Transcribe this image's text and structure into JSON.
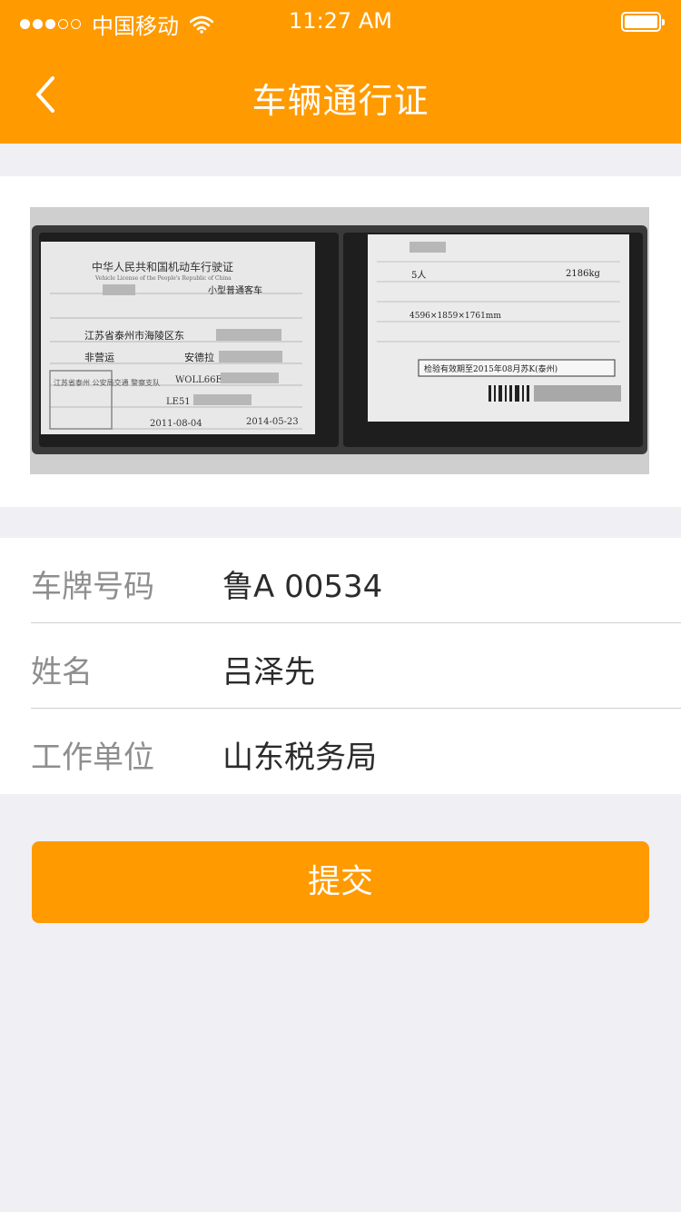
{
  "status_bar": {
    "carrier": "中国移动",
    "time": "11:27 AM",
    "signal_icon": "signal-dots-icon",
    "wifi_icon": "wifi-icon",
    "battery_icon": "battery-icon"
  },
  "nav": {
    "title": "车辆通行证",
    "back_icon": "chevron-left-icon"
  },
  "license_photo": {
    "left_page": {
      "title": "中华人民共和国机动车行驶证",
      "vehicle_type": "小型普通客车",
      "address": "江苏省泰州市海陵区东",
      "use_nature": "非营运",
      "brand": "安德拉",
      "vin": "WOLL66E15",
      "engine": "LE51",
      "register_date": "2011-08-04",
      "issue_date": "2014-05-23",
      "seal_text": "江苏省泰州 公安局交通 警察支队"
    },
    "right_page": {
      "seats": "5人",
      "total_mass": "2186kg",
      "dimensions": "4596×1859×1761mm",
      "inspection": "检验有效期至2015年08月苏K(泰州)"
    }
  },
  "form": {
    "rows": [
      {
        "label": "车牌号码",
        "value": "鲁A 00534"
      },
      {
        "label": "姓名",
        "value": "吕泽先"
      },
      {
        "label": "工作单位",
        "value": "山东税务局"
      }
    ]
  },
  "submit_label": "提交",
  "colors": {
    "accent": "#ff9a00",
    "background": "#efeff4",
    "label_gray": "#8e8e8e"
  }
}
